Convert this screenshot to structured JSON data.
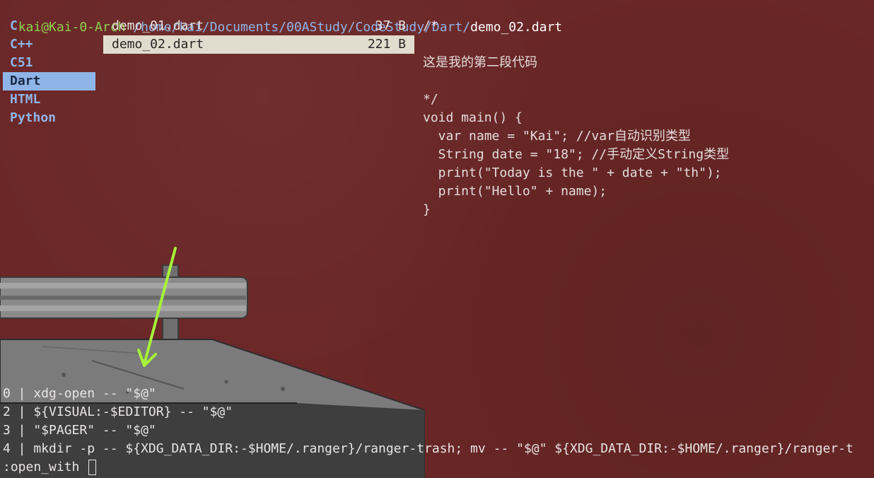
{
  "header": {
    "user_host": "kai@Kai-0-Arch",
    "path": "/home/kai/Documents/00AStudy/CodeStudy/Dart/",
    "file": "demo_02.dart"
  },
  "folders": {
    "items": [
      "C",
      "C++",
      "C51",
      "Dart",
      "HTML",
      "Python"
    ],
    "selected": "Dart"
  },
  "files": {
    "items": [
      {
        "name": "demo_01.dart",
        "size": "37 B"
      },
      {
        "name": "demo_02.dart",
        "size": "221 B"
      }
    ]
  },
  "preview": {
    "lines": [
      "/*",
      "",
      "这是我的第二段代码",
      "",
      "*/",
      "void main() {",
      "  var name = \"Kai\"; //var自动识别类型",
      "  String date = \"18\"; //手动定义String类型",
      "  print(\"Today is the \" + date + \"th\");",
      "  print(\"Hello\" + name);",
      "}"
    ]
  },
  "open_with": {
    "options": [
      "0 | xdg-open -- \"$@\"",
      "2 | ${VISUAL:-$EDITOR} -- \"$@\"",
      "3 | \"$PAGER\" -- \"$@\"",
      "4 | mkdir -p -- ${XDG_DATA_DIR:-$HOME/.ranger}/ranger-trash; mv -- \"$@\" ${XDG_DATA_DIR:-$HOME/.ranger}/ranger-t"
    ],
    "prompt": ":open_with "
  }
}
